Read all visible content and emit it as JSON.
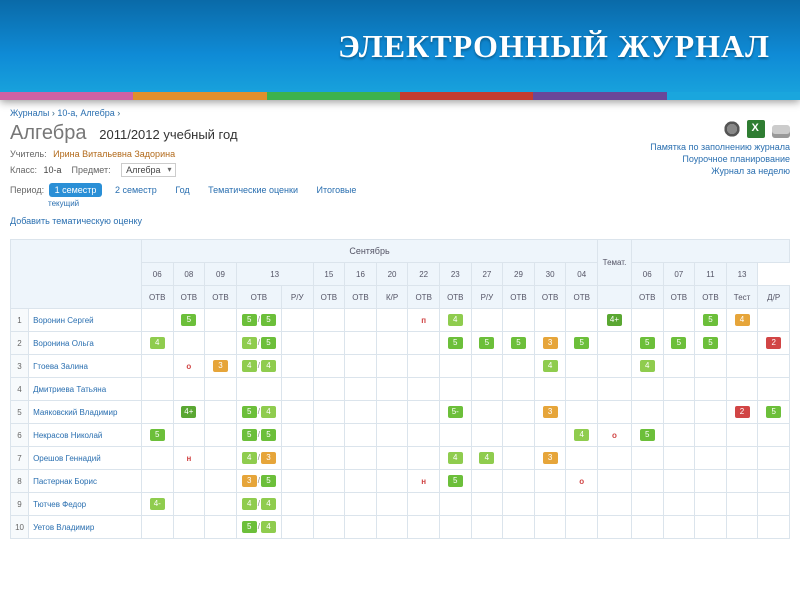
{
  "banner": {
    "title": "ЭЛЕКТРОННЫЙ ЖУРНАЛ"
  },
  "breadcrumb": {
    "root": "Журналы",
    "class": "10-а, Алгебра"
  },
  "header": {
    "subject": "Алгебра",
    "year": "2011/2012 учебный год",
    "teacher_label": "Учитель:",
    "teacher": "Ирина Витальевна Задорина",
    "class_label": "Класс:",
    "class": "10-а",
    "subject_label": "Предмет:",
    "subject_sel": "Алгебра",
    "period_label": "Период:",
    "period_active": "1 семестр",
    "period_2": "2 семестр",
    "period_year": "Год",
    "period_tem": "Тематические оценки",
    "period_itog": "Итоговые",
    "period_sub": "текущий",
    "add_link": "Добавить тематическую оценку"
  },
  "right_links": {
    "l1": "Памятка по заполнению журнала",
    "l2": "Поурочное планирование",
    "l3": "Журнал за неделю"
  },
  "grid": {
    "month1": "Сентябрь",
    "col_temat": "Темат.",
    "dates": [
      "06",
      "08",
      "09",
      "13",
      "15",
      "16",
      "20",
      "22",
      "23",
      "27",
      "29",
      "30"
    ],
    "dates2": [
      "04",
      "06",
      "07",
      "11",
      "13"
    ],
    "types": [
      "ОТВ",
      "ОТВ",
      "ОТВ",
      "ОТВ",
      "Р/У",
      "ОТВ",
      "ОТВ",
      "К/Р",
      "ОТВ",
      "ОТВ",
      "Р/У",
      "ОТВ",
      "ОТВ",
      "ОТВ",
      "",
      "ОТВ",
      "ОТВ",
      "ОТВ",
      "Тест",
      "Д/Р"
    ],
    "students": [
      {
        "n": "1",
        "name": "Воронин Сергей"
      },
      {
        "n": "2",
        "name": "Воронина Ольга"
      },
      {
        "n": "3",
        "name": "Гтоева Залина"
      },
      {
        "n": "4",
        "name": "Дмитриева Татьяна"
      },
      {
        "n": "5",
        "name": "Маяковский Владимир"
      },
      {
        "n": "6",
        "name": "Некрасов Николай"
      },
      {
        "n": "7",
        "name": "Орешов Геннадий"
      },
      {
        "n": "8",
        "name": "Пастернак Борис"
      },
      {
        "n": "9",
        "name": "Тютчев Федор"
      },
      {
        "n": "10",
        "name": "Уетов Владимир"
      }
    ],
    "cells": {
      "1": {
        "1": [
          {
            "g": "5",
            "c": "g5"
          }
        ],
        "3": [
          {
            "g": "5",
            "c": "g5"
          },
          {
            "g": "5",
            "c": "g5"
          }
        ],
        "8": [
          {
            "t": "п"
          }
        ],
        "9": [
          {
            "g": "4",
            "c": "g4"
          }
        ],
        "14": [
          {
            "g": "4+",
            "c": "g4p"
          }
        ],
        "17": [
          {
            "g": "5",
            "c": "g5"
          }
        ],
        "18": [
          {
            "g": "4",
            "c": "g3"
          }
        ]
      },
      "2": {
        "0": [
          {
            "g": "4",
            "c": "g4"
          }
        ],
        "3": [
          {
            "g": "4",
            "c": "g4"
          },
          {
            "g": "5",
            "c": "g5"
          }
        ],
        "9": [
          {
            "g": "5",
            "c": "g5"
          }
        ],
        "10": [
          {
            "g": "5",
            "c": "g5"
          }
        ],
        "11": [
          {
            "g": "5",
            "c": "g5"
          }
        ],
        "12": [
          {
            "g": "3",
            "c": "g3"
          }
        ],
        "13": [
          {
            "g": "5",
            "c": "g5"
          }
        ],
        "15": [
          {
            "g": "5",
            "c": "g5"
          }
        ],
        "16": [
          {
            "g": "5",
            "c": "g5"
          }
        ],
        "17": [
          {
            "g": "5",
            "c": "g5"
          }
        ],
        "19": [
          {
            "g": "2",
            "c": "g2"
          }
        ]
      },
      "3": {
        "1": [
          {
            "t": "о"
          }
        ],
        "2": [
          {
            "g": "3",
            "c": "g3"
          }
        ],
        "3": [
          {
            "g": "4",
            "c": "g4"
          },
          {
            "g": "4",
            "c": "g4"
          }
        ],
        "12": [
          {
            "g": "4",
            "c": "g4"
          }
        ],
        "15": [
          {
            "g": "4",
            "c": "g4"
          }
        ]
      },
      "4": {},
      "5": {
        "1": [
          {
            "g": "4+",
            "c": "g4p"
          }
        ],
        "3": [
          {
            "g": "5",
            "c": "g5"
          },
          {
            "g": "4",
            "c": "g4"
          }
        ],
        "9": [
          {
            "g": "5-",
            "c": "g5m"
          }
        ],
        "12": [
          {
            "g": "3",
            "c": "g3"
          }
        ],
        "18": [
          {
            "g": "2",
            "c": "g2"
          }
        ],
        "19": [
          {
            "g": "5",
            "c": "g5"
          }
        ]
      },
      "6": {
        "0": [
          {
            "g": "5",
            "c": "g5"
          }
        ],
        "3": [
          {
            "g": "5",
            "c": "g5"
          },
          {
            "g": "5",
            "c": "g5"
          }
        ],
        "13": [
          {
            "g": "4",
            "c": "g4"
          }
        ],
        "14": [
          {
            "t": "о"
          }
        ],
        "15": [
          {
            "g": "5",
            "c": "g5"
          }
        ]
      },
      "7": {
        "1": [
          {
            "t": "н"
          }
        ],
        "3": [
          {
            "g": "4",
            "c": "g4"
          },
          {
            "g": "3",
            "c": "g3"
          }
        ],
        "9": [
          {
            "g": "4",
            "c": "g4"
          }
        ],
        "10": [
          {
            "g": "4",
            "c": "g4"
          }
        ],
        "12": [
          {
            "g": "3",
            "c": "g3"
          }
        ]
      },
      "8": {
        "3": [
          {
            "g": "3",
            "c": "g3"
          },
          {
            "g": "5",
            "c": "g5"
          }
        ],
        "8": [
          {
            "t": "н"
          }
        ],
        "9": [
          {
            "g": "5",
            "c": "g5"
          }
        ],
        "13": [
          {
            "t": "о"
          }
        ]
      },
      "9": {
        "0": [
          {
            "g": "4-",
            "c": "g4"
          }
        ],
        "3": [
          {
            "g": "4",
            "c": "g4"
          },
          {
            "g": "4",
            "c": "g4"
          }
        ]
      },
      "10": {
        "3": [
          {
            "g": "5",
            "c": "g5"
          },
          {
            "g": "4",
            "c": "g4"
          }
        ]
      }
    }
  }
}
